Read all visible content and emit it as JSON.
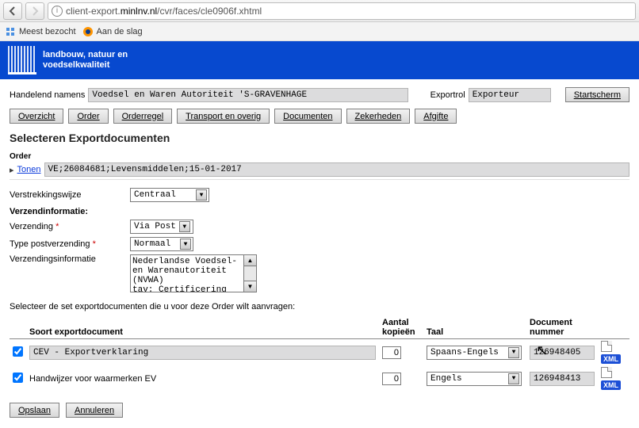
{
  "browser": {
    "url_prefix": "client-export.",
    "url_host": "minlnv.nl",
    "url_path": "/cvr/faces/cle0906f.xhtml",
    "bookmarks": {
      "most_visited": "Meest bezocht",
      "get_started": "Aan de slag"
    }
  },
  "brand": {
    "line1": "landbouw, natuur en",
    "line2": "voedselkwaliteit"
  },
  "header": {
    "acting_label": "Handelend namens",
    "acting_value": "Voedsel en Waren Autoriteit 'S-GRAVENHAGE",
    "role_label": "Exportrol",
    "role_value": "Exporteur",
    "start_button": "Startscherm"
  },
  "tabs": [
    "Overzicht",
    "Order",
    "Orderregel",
    "Transport en overig",
    "Documenten",
    "Zekerheden",
    "Afgifte"
  ],
  "page_title": "Selecteren Exportdocumenten",
  "order": {
    "section": "Order",
    "toggle": "Tonen",
    "value": "VE;26084681;Levensmiddelen;15-01-2017"
  },
  "form": {
    "verstrekking_label": "Verstrekkingswijze",
    "verstrekking_value": "Centraal",
    "verzendinfo_heading": "Verzendinformatie:",
    "verzending_label": "Verzending",
    "verzending_value": "Via Post",
    "typepost_label": "Type postverzending",
    "typepost_value": "Normaal",
    "verzendinfo_label": "Verzendingsinformatie",
    "verzendinfo_text": "Nederlandse Voedsel-\nen Warenautoriteit\n(NVWA)\ntav: Certificering op"
  },
  "select_prompt": "Selecteer de set exportdocumenten die u voor deze Order wilt aanvragen:",
  "table": {
    "headers": {
      "soort": "Soort exportdocument",
      "aantal": "Aantal\nkopieën",
      "taal": "Taal",
      "docnr": "Document\nnummer"
    },
    "rows": [
      {
        "checked": true,
        "soort": "CEV - Exportverklaring",
        "kopieen": "0",
        "taal": "Spaans-Engels",
        "docnr": "126948405",
        "xml": "XML"
      },
      {
        "checked": true,
        "soort": "Handwijzer voor waarmerken EV",
        "kopieen": "0",
        "taal": "Engels",
        "docnr": "126948413",
        "xml": "XML"
      }
    ]
  },
  "actions": {
    "save": "Opslaan",
    "cancel": "Annuleren"
  }
}
